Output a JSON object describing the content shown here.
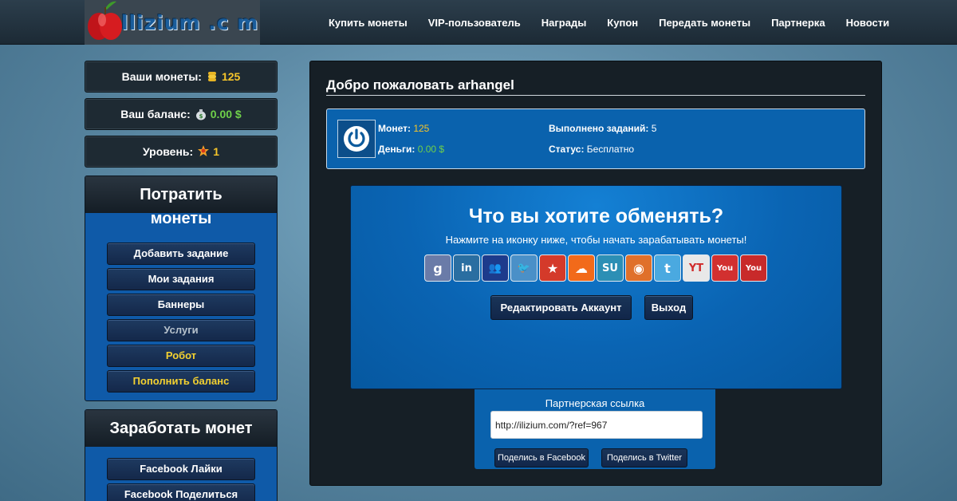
{
  "logo": {
    "text": "llizium .c m"
  },
  "nav": [
    "Купить монеты",
    "VIP-пользователь",
    "Награды",
    "Купон",
    "Передать монеты",
    "Партнерка",
    "Новости"
  ],
  "stats": {
    "coins_label": "Ваши монеты:",
    "coins_value": "125",
    "balance_label": "Ваш баланс:",
    "balance_value": "0.00 $",
    "level_label": "Уровень:",
    "level_value": "1"
  },
  "spend_panel": {
    "title_line1": "Потратить",
    "title_line2": "монеты",
    "items": [
      "Добавить задание",
      "Мои задания",
      "Баннеры",
      "Услуги",
      "Робот",
      "Пополнить баланс"
    ]
  },
  "earn_panel": {
    "title": "Заработать монет",
    "items": [
      "Facebook Лайки",
      "Facebook Поделиться"
    ]
  },
  "main": {
    "welcome": "Добро пожаловать arhangel",
    "info": {
      "coins_label": "Монет:",
      "coins_value": "125",
      "money_label": "Деньги:",
      "money_value": "0.00 $",
      "tasks_label": "Выполнено заданий:",
      "tasks_value": "5",
      "status_label": "Статус:",
      "status_value": "Бесплатно"
    },
    "exchange": {
      "title": "Что вы хотите обменять?",
      "subtitle": "Нажмите на иконку ниже, чтобы начать зарабатывать монеты!",
      "icons": [
        {
          "name": "google-icon",
          "glyph": "g",
          "color": "#6a7ba8"
        },
        {
          "name": "linkedin-icon",
          "glyph": "in",
          "color": "#2a6ea1"
        },
        {
          "name": "myspace-icon",
          "glyph": "👥",
          "color": "#1d3b8c"
        },
        {
          "name": "twitter-bird-icon",
          "glyph": "🐦",
          "color": "#4a90c8"
        },
        {
          "name": "reverbnation-icon",
          "glyph": "★",
          "color": "#d43a2a"
        },
        {
          "name": "soundcloud-icon",
          "glyph": "☁",
          "color": "#f26a1a"
        },
        {
          "name": "stumbleupon-icon",
          "glyph": "SU",
          "color": "#2c8fb5"
        },
        {
          "name": "rss-icon",
          "glyph": "◉",
          "color": "#e0702a"
        },
        {
          "name": "twitter-icon",
          "glyph": "t",
          "color": "#4aa9e0"
        },
        {
          "name": "youtube-yt-icon",
          "glyph": "YT",
          "color": "#e8e8e8"
        },
        {
          "name": "youtube-icon",
          "glyph": "You",
          "color": "#d23030"
        },
        {
          "name": "youtube-alt-icon",
          "glyph": "You",
          "color": "#c82a2a"
        }
      ],
      "edit_account": "Редактировать Аккаунт",
      "logout": "Выход"
    },
    "referral": {
      "label": "Партнерская ссылка",
      "url": "http://ilizium.com/?ref=967",
      "share_facebook": "Поделись в Facebook",
      "share_twitter": "Поделись в Twitter"
    }
  }
}
